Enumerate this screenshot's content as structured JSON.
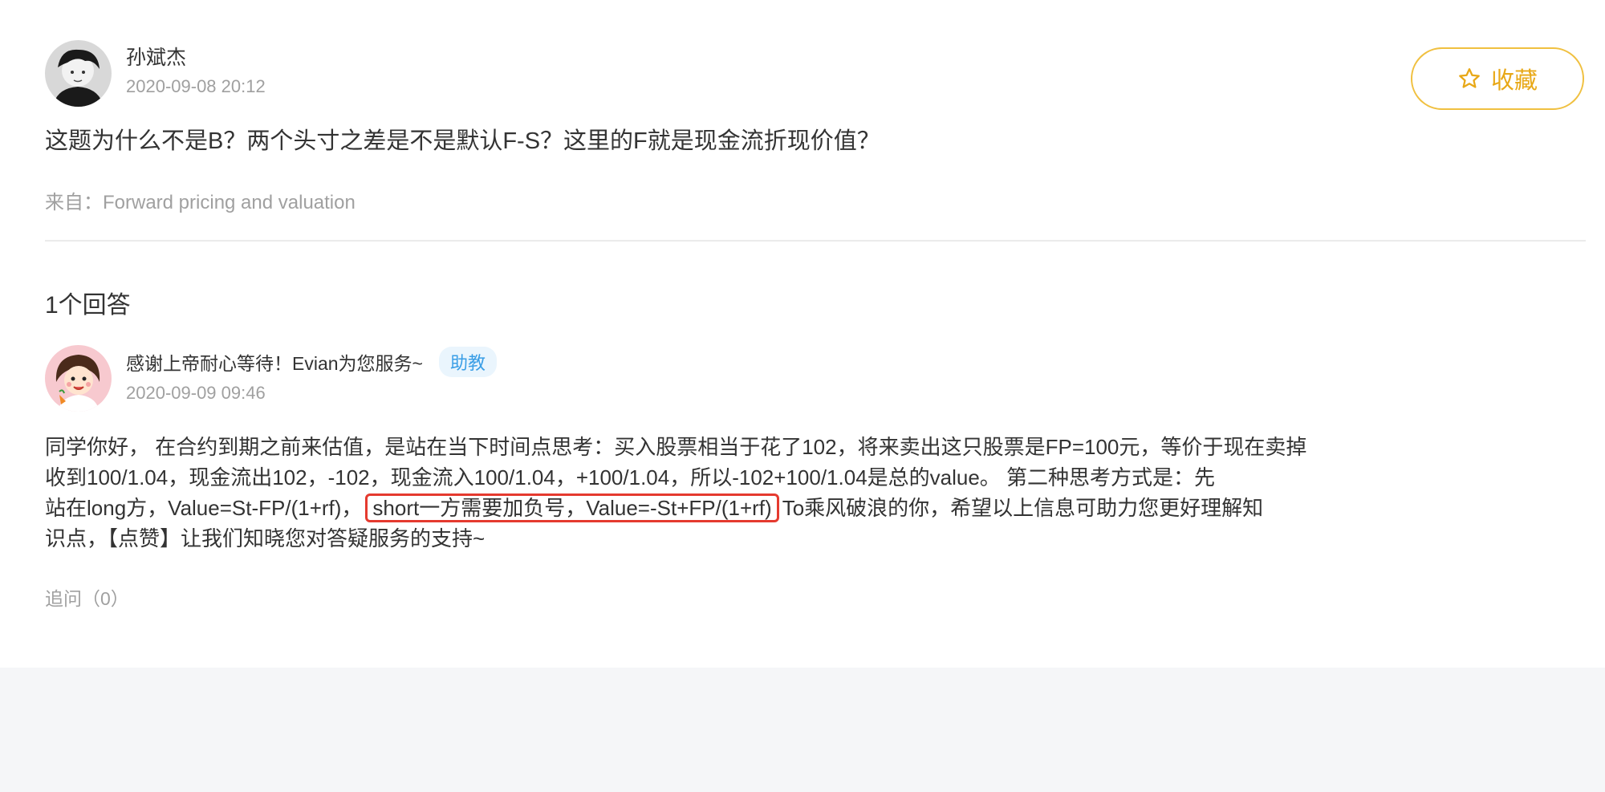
{
  "question": {
    "author": "孙斌杰",
    "time": "2020-09-08 20:12",
    "text": "这题为什么不是B？两个头寸之差是不是默认F-S？这里的F就是现金流折现价值？",
    "source": "来自：Forward pricing and valuation",
    "favorite_label": "收藏",
    "favorite_icon": "star-outline-icon",
    "accent_color": "#e8a817"
  },
  "answers": {
    "count_label": "1个回答"
  },
  "answer": {
    "author": "感谢上帝耐心等待！Evian为您服务~",
    "role_badge": "助教",
    "time": "2020-09-09 09:46",
    "body": {
      "line1": "同学你好， 在合约到期之前来估值，是站在当下时间点思考：买入股票相当于花了102，将来卖出这只股票是FP=100元，等价于现在卖掉",
      "line2": "收到100/1.04，现金流出102，-102，现金流入100/1.04，+100/1.04，所以-102+100/1.04是总的value。 第二种思考方式是：先",
      "line3_before": "站在long方，Value=St-FP/(1+rf)，",
      "line3_highlight": "short一方需要加负号，Value=-St+FP/(1+rf)",
      "line3_after": "To乘风破浪的你，希望以上信息可助力您更好理解知",
      "line4": "识点，【点赞】让我们知晓您对答疑服务的支持~"
    },
    "highlight_color": "#e53a2f",
    "followup_label": "追问（0）"
  }
}
